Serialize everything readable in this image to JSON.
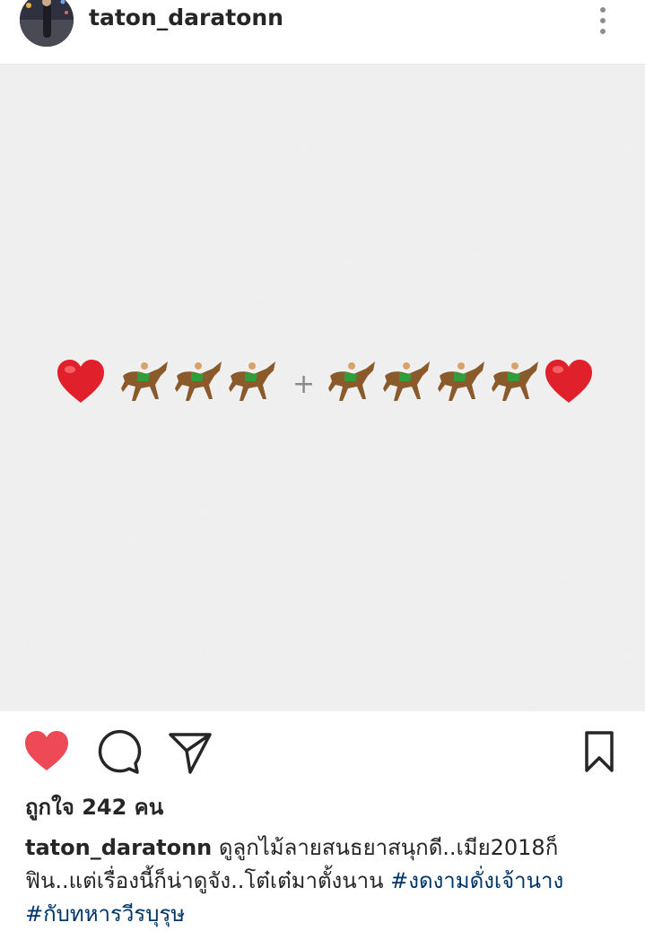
{
  "post": {
    "username": "taton_daratonn",
    "more_icon": "more-vertical-icon",
    "image": {
      "emoji_sequence": [
        "❤️",
        "🏇",
        "🏇",
        "🏇",
        "+",
        "🏇",
        "🏇",
        "🏇",
        "🏇",
        "❤️"
      ],
      "plus_text": "+"
    },
    "actions": {
      "like_icon": "heart-filled-icon",
      "comment_icon": "comment-icon",
      "share_icon": "send-icon",
      "save_icon": "bookmark-icon",
      "like_color": "#ed4956"
    },
    "likes_text": "ถูกใจ 242 คน",
    "caption": {
      "username": "taton_daratonn",
      "line1_text": "ดูลูกไม้ลายสนธยาสนุกดี..เมีย2018ก็",
      "line2_text": "ฟิน..แต่เรื่องนี้ก็น่าดูจัง..โต๋เต๋มาตั้งนาน ",
      "hashtags": [
        "#งดงามดั่งเจ้านาง",
        "#กับทหารวีรบุรุษ"
      ]
    }
  },
  "colors": {
    "text": "#262626",
    "hashtag": "#003569",
    "like_red": "#ed4956",
    "image_bg": "#f2f2f2"
  }
}
